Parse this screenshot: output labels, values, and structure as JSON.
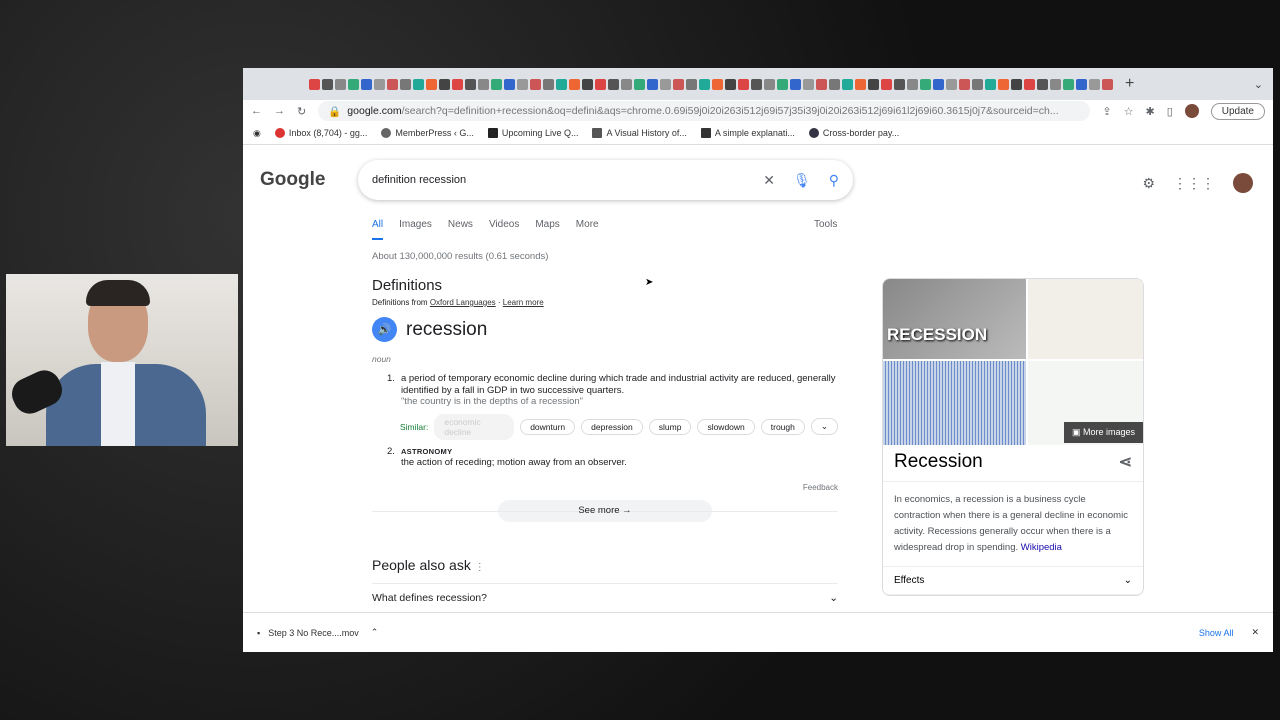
{
  "browser": {
    "url_host": "google.com",
    "url_rest": "/search?q=definition+recession&oq=defini&aqs=chrome.0.69i59j0i20i263i512j69i57j35i39j0i20i263i512j69i61l2j69i60.3615j0j7&sourceid=ch...",
    "update_label": "Update",
    "bookmarks": [
      "Inbox (8,704) - gg...",
      "MemberPress ‹ G...",
      "Upcoming Live Q...",
      "A Visual History of...",
      "A simple explanati...",
      "Cross-border pay..."
    ]
  },
  "google": {
    "logo": "Google",
    "query": "definition recession",
    "nav": [
      "All",
      "Images",
      "News",
      "Videos",
      "Maps",
      "More"
    ],
    "tools": "Tools",
    "stats": "About 130,000,000 results (0.61 seconds)",
    "definitions": {
      "heading": "Definitions",
      "source_prefix": "Definitions from",
      "source": "Oxford Languages",
      "learn_more": "Learn more",
      "word": "recession",
      "pos": "noun",
      "def1_num": "1.",
      "def1": "a period of temporary economic decline during which trade and industrial activity are reduced, generally identified by a fall in GDP in two successive quarters.",
      "def1_example": "\"the country is in the depths of a recession\"",
      "similar_label": "Similar:",
      "similar": [
        "economic decline",
        "downturn",
        "depression",
        "slump",
        "slowdown",
        "trough"
      ],
      "def2_num": "2.",
      "def2_domain": "ASTRONOMY",
      "def2": "the action of receding; motion away from an observer.",
      "feedback": "Feedback",
      "see_more": "See more"
    },
    "paa": {
      "heading": "People also ask",
      "q1": "What defines recession?"
    },
    "panel": {
      "image_text": "RECESSION",
      "more_images": "More images",
      "title": "Recession",
      "desc": "In economics, a recession is a business cycle contraction when there is a general decline in economic activity. Recessions generally occur when there is a widespread drop in spending.",
      "wiki": "Wikipedia",
      "effects": "Effects"
    }
  },
  "download": {
    "file": "Step 3 No Rece....mov",
    "show_all": "Show All"
  }
}
